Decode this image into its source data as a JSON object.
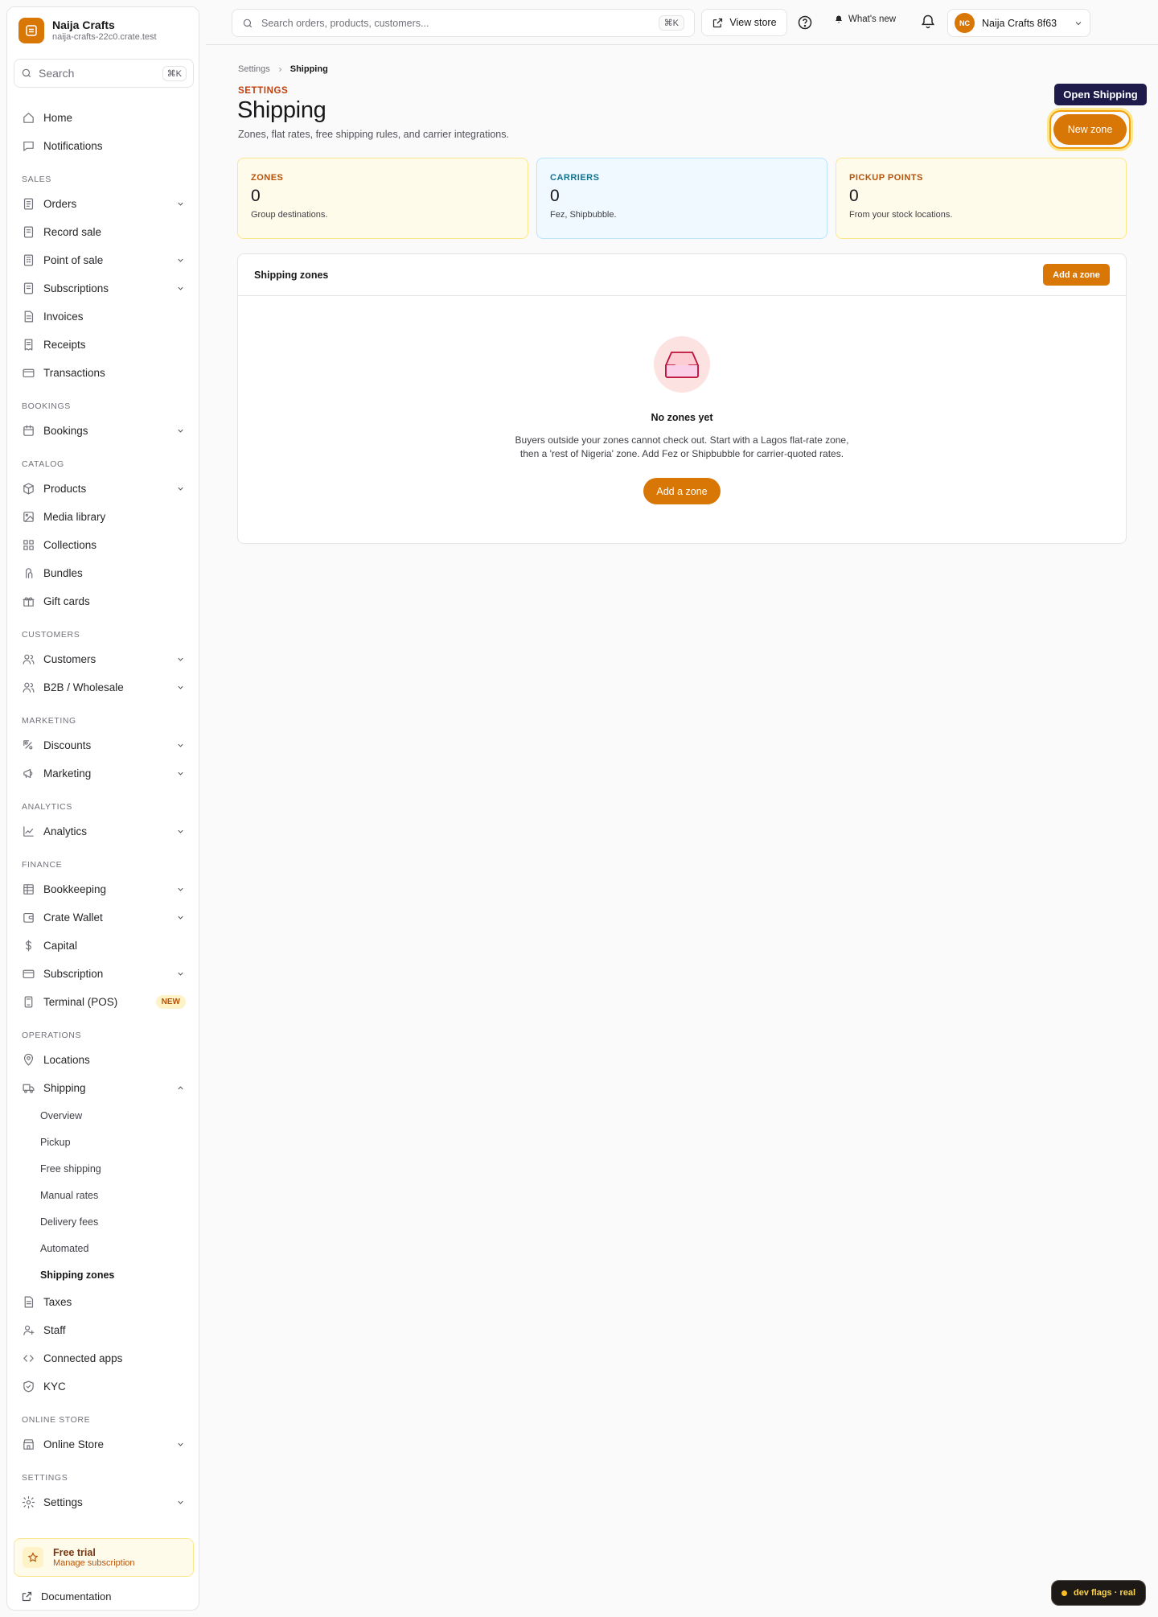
{
  "brand": {
    "name": "Naija Crafts",
    "domain": "naija-crafts-22c0.crate.test"
  },
  "sidebar": {
    "search_placeholder": "Search",
    "search_shortcut": "⌘K",
    "items": [
      {
        "type": "item",
        "label": "Home",
        "icon": "home-icon"
      },
      {
        "type": "item",
        "label": "Notifications",
        "icon": "chat-icon"
      },
      {
        "type": "section",
        "label": "SALES"
      },
      {
        "type": "item",
        "label": "Orders",
        "icon": "orders-icon",
        "chevron": "down"
      },
      {
        "type": "item",
        "label": "Record sale",
        "icon": "document-icon"
      },
      {
        "type": "item",
        "label": "Point of sale",
        "icon": "pos-icon",
        "chevron": "down"
      },
      {
        "type": "item",
        "label": "Subscriptions",
        "icon": "document-icon",
        "chevron": "down"
      },
      {
        "type": "item",
        "label": "Invoices",
        "icon": "file-icon"
      },
      {
        "type": "item",
        "label": "Receipts",
        "icon": "receipt-icon"
      },
      {
        "type": "item",
        "label": "Transactions",
        "icon": "card-icon"
      },
      {
        "type": "section",
        "label": "BOOKINGS"
      },
      {
        "type": "item",
        "label": "Bookings",
        "icon": "calendar-icon",
        "chevron": "down"
      },
      {
        "type": "section",
        "label": "CATALOG"
      },
      {
        "type": "item",
        "label": "Products",
        "icon": "box-icon",
        "chevron": "down"
      },
      {
        "type": "item",
        "label": "Media library",
        "icon": "image-icon"
      },
      {
        "type": "item",
        "label": "Collections",
        "icon": "grid-icon"
      },
      {
        "type": "item",
        "label": "Bundles",
        "icon": "bundle-icon"
      },
      {
        "type": "item",
        "label": "Gift cards",
        "icon": "gift-icon"
      },
      {
        "type": "section",
        "label": "CUSTOMERS"
      },
      {
        "type": "item",
        "label": "Customers",
        "icon": "users-icon",
        "chevron": "down"
      },
      {
        "type": "item",
        "label": "B2B / Wholesale",
        "icon": "users-icon",
        "chevron": "down"
      },
      {
        "type": "section",
        "label": "MARKETING"
      },
      {
        "type": "item",
        "label": "Discounts",
        "icon": "discount-icon",
        "chevron": "down"
      },
      {
        "type": "item",
        "label": "Marketing",
        "icon": "megaphone-icon",
        "chevron": "down"
      },
      {
        "type": "section",
        "label": "ANALYTICS"
      },
      {
        "type": "item",
        "label": "Analytics",
        "icon": "chart-icon",
        "chevron": "down"
      },
      {
        "type": "section",
        "label": "FINANCE"
      },
      {
        "type": "item",
        "label": "Bookkeeping",
        "icon": "table-icon",
        "chevron": "down"
      },
      {
        "type": "item",
        "label": "Crate Wallet",
        "icon": "wallet-icon",
        "chevron": "down"
      },
      {
        "type": "item",
        "label": "Capital",
        "icon": "dollar-icon"
      },
      {
        "type": "item",
        "label": "Subscription",
        "icon": "card-icon",
        "chevron": "down"
      },
      {
        "type": "item",
        "label": "Terminal (POS)",
        "icon": "terminal-icon",
        "badge": "NEW"
      },
      {
        "type": "section",
        "label": "OPERATIONS"
      },
      {
        "type": "item",
        "label": "Locations",
        "icon": "pin-icon"
      },
      {
        "type": "item",
        "label": "Shipping",
        "icon": "truck-icon",
        "chevron": "up"
      },
      {
        "type": "sub",
        "label": "Overview"
      },
      {
        "type": "sub",
        "label": "Pickup"
      },
      {
        "type": "sub",
        "label": "Free shipping"
      },
      {
        "type": "sub",
        "label": "Manual rates"
      },
      {
        "type": "sub",
        "label": "Delivery fees"
      },
      {
        "type": "sub",
        "label": "Automated"
      },
      {
        "type": "sub",
        "label": "Shipping zones",
        "active": true
      },
      {
        "type": "item",
        "label": "Taxes",
        "icon": "file-icon"
      },
      {
        "type": "item",
        "label": "Staff",
        "icon": "user-plus-icon"
      },
      {
        "type": "item",
        "label": "Connected apps",
        "icon": "code-icon"
      },
      {
        "type": "item",
        "label": "KYC",
        "icon": "shield-icon"
      },
      {
        "type": "section",
        "label": "ONLINE STORE"
      },
      {
        "type": "item",
        "label": "Online Store",
        "icon": "store-icon",
        "chevron": "down"
      },
      {
        "type": "section",
        "label": "SETTINGS"
      },
      {
        "type": "item",
        "label": "Settings",
        "icon": "gear-icon",
        "chevron": "down"
      }
    ],
    "trial": {
      "title": "Free trial",
      "subtitle": "Manage subscription"
    },
    "documentation": "Documentation"
  },
  "topbar": {
    "search_placeholder": "Search orders, products, customers...",
    "search_shortcut": "⌘K",
    "view_store": "View store",
    "whats_new": "What's new",
    "account_initials": "NC",
    "account_name": "Naija Crafts 8f63"
  },
  "main": {
    "breadcrumb": [
      "Settings",
      "Shipping"
    ],
    "eyebrow": "SETTINGS",
    "title": "Shipping",
    "description": "Zones, flat rates, free shipping rules, and carrier integrations.",
    "tooltip": "Open Shipping",
    "new_zone_label": "New zone",
    "stats": [
      {
        "label": "ZONES",
        "value": "0",
        "sub": "Group destinations."
      },
      {
        "label": "CARRIERS",
        "value": "0",
        "sub": "Fez, Shipbubble."
      },
      {
        "label": "PICKUP POINTS",
        "value": "0",
        "sub": "From your stock locations."
      }
    ],
    "zones_card": {
      "title": "Shipping zones",
      "add_label": "Add a zone",
      "empty_title": "No zones yet",
      "empty_desc_line1": "Buyers outside your zones cannot check out. Start with a Lagos flat-rate zone,",
      "empty_desc_line2": "then a 'rest of Nigeria' zone. Add Fez or Shipbubble for carrier-quoted rates.",
      "empty_cta": "Add a zone"
    }
  },
  "dev_flags": "dev flags · real",
  "colors": {
    "accent": "#d97706",
    "tooltip": "#1e1b4b",
    "empty_icon": "#be123c"
  }
}
